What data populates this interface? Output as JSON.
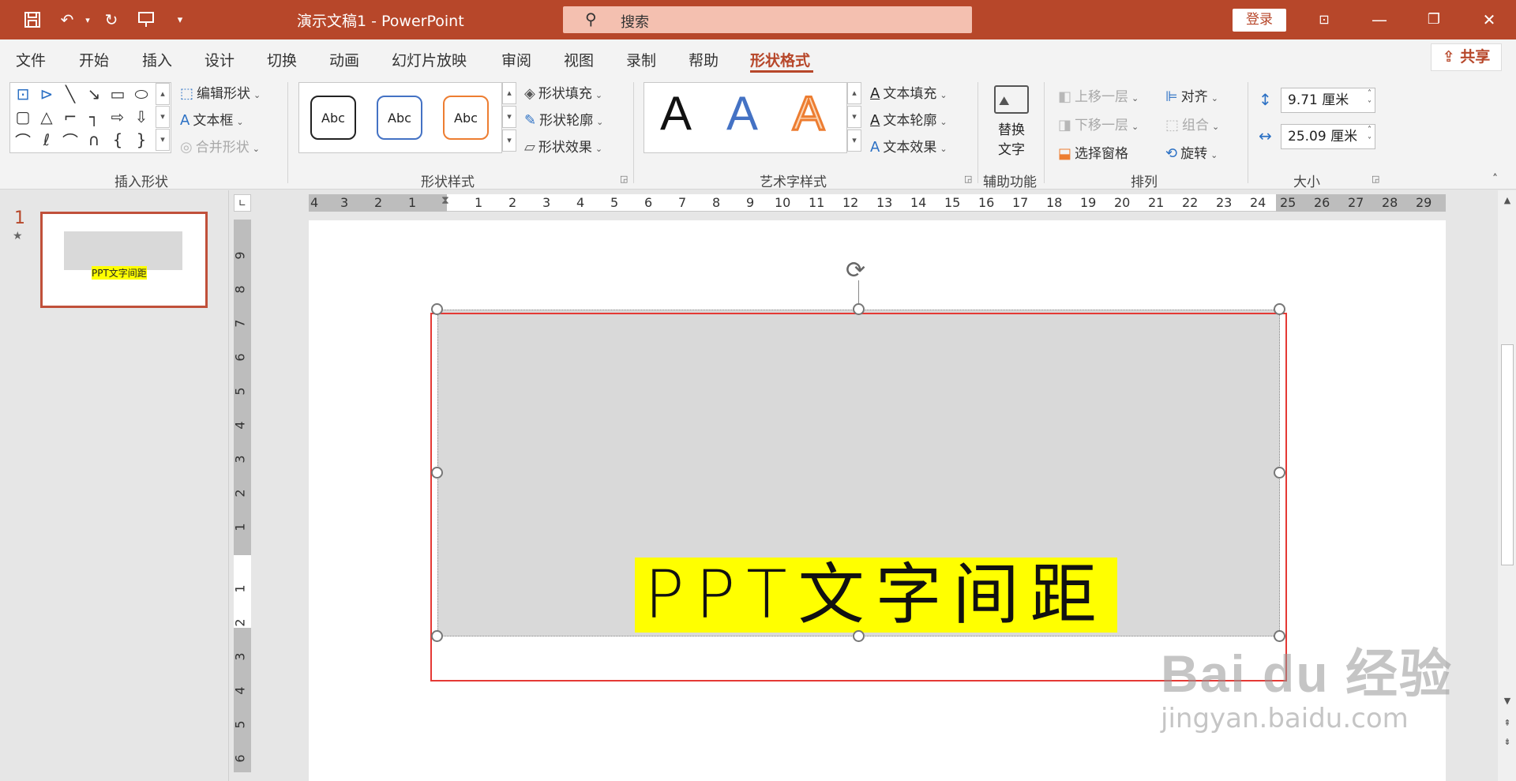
{
  "titlebar": {
    "title": "演示文稿1  -  PowerPoint",
    "search_placeholder": "搜索",
    "login_label": "登录",
    "quick_access": [
      "save-icon",
      "undo-icon",
      "redo-icon",
      "present-icon",
      "customize-icon"
    ],
    "window_controls": [
      "ribbon-display-icon",
      "minimize-icon",
      "restore-icon",
      "close-icon"
    ]
  },
  "tabs": [
    {
      "label": "文件"
    },
    {
      "label": "开始"
    },
    {
      "label": "插入"
    },
    {
      "label": "设计"
    },
    {
      "label": "切换"
    },
    {
      "label": "动画"
    },
    {
      "label": "幻灯片放映"
    },
    {
      "label": "审阅"
    },
    {
      "label": "视图"
    },
    {
      "label": "录制"
    },
    {
      "label": "帮助"
    },
    {
      "label": "形状格式",
      "active": true
    }
  ],
  "share_label": "共享",
  "ribbon": {
    "insert_shapes": {
      "label": "插入形状",
      "edit_shape": "编辑形状",
      "text_box": "文本框",
      "merge_shapes": "合并形状"
    },
    "shape_styles": {
      "label": "形状样式",
      "samples": [
        "Abc",
        "Abc",
        "Abc"
      ],
      "sample_colors": [
        "#222222",
        "#4472c4",
        "#ed7d31"
      ],
      "fill": "形状填充",
      "outline": "形状轮廓",
      "effects": "形状效果"
    },
    "wordart": {
      "label": "艺术字样式",
      "samples": [
        "A",
        "A",
        "A"
      ],
      "text_fill": "文本填充",
      "text_outline": "文本轮廓",
      "text_effects": "文本效果"
    },
    "accessibility": {
      "label": "辅助功能",
      "alt_text_line1": "替换",
      "alt_text_line2": "文字"
    },
    "arrange": {
      "label": "排列",
      "bring_forward": "上移一层",
      "send_backward": "下移一层",
      "selection_pane": "选择窗格",
      "align": "对齐",
      "group": "组合",
      "rotate": "旋转"
    },
    "size": {
      "label": "大小",
      "height": "9.71 厘米",
      "width": "25.09 厘米"
    }
  },
  "thumbnail": {
    "number": "1",
    "text": "PPT文字间距"
  },
  "rulers": {
    "horizontal": [
      "4",
      "3",
      "2",
      "1",
      "1",
      "2",
      "3",
      "4",
      "5",
      "6",
      "7",
      "8",
      "9",
      "10",
      "11",
      "12",
      "13",
      "14",
      "15",
      "16",
      "17",
      "18",
      "19",
      "20",
      "21",
      "22",
      "23",
      "24",
      "25",
      "26",
      "27",
      "28",
      "29"
    ],
    "vertical": [
      "9",
      "8",
      "7",
      "6",
      "5",
      "4",
      "3",
      "2",
      "1",
      "1",
      "2",
      "3",
      "4",
      "5",
      "6"
    ]
  },
  "slide": {
    "main_text": "PPT文字间距",
    "highlight_color": "#ffff00",
    "shape_fill": "#d9d9d9",
    "frame_color": "#e53935"
  },
  "watermark": {
    "logo": "Bai du 经验",
    "url": "jingyan.baidu.com"
  }
}
